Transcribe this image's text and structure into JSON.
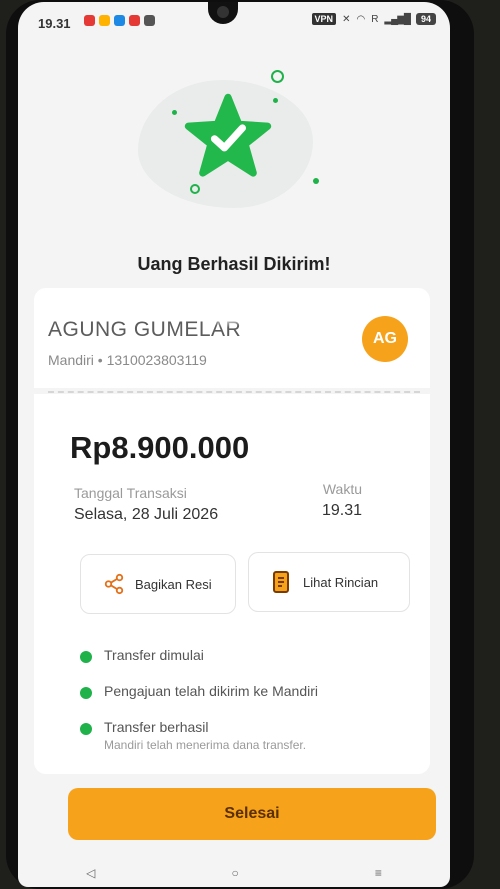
{
  "status_bar": {
    "time": "19.31",
    "vpn_label": "VPN",
    "signal_label": "R",
    "battery": "94"
  },
  "colors": {
    "accent": "#f7a21b",
    "success": "#1fb24a"
  },
  "hero": {
    "icon": "success-star-check-icon"
  },
  "success_title": "Uang Berhasil Dikirim!",
  "recipient": {
    "name": "AGUNG GUMELAR",
    "account": "Mandiri • 1310023803119",
    "initials": "AG"
  },
  "transaction": {
    "amount": "Rp8.900.000",
    "date_label": "Tanggal Transaksi",
    "date_value": "Selasa, 28 Juli 2026",
    "time_label": "Waktu",
    "time_value": "19.31"
  },
  "actions": {
    "share_label": "Bagikan Resi",
    "share_icon": "share-icon",
    "detail_label": "Lihat Rincian",
    "detail_icon": "receipt-icon"
  },
  "timeline": [
    {
      "title": "Transfer dimulai",
      "subtitle": ""
    },
    {
      "title": "Pengajuan telah dikirim ke Mandiri",
      "subtitle": ""
    },
    {
      "title": "Transfer berhasil",
      "subtitle": "Mandiri telah menerima dana transfer."
    }
  ],
  "done_button": "Selesai"
}
